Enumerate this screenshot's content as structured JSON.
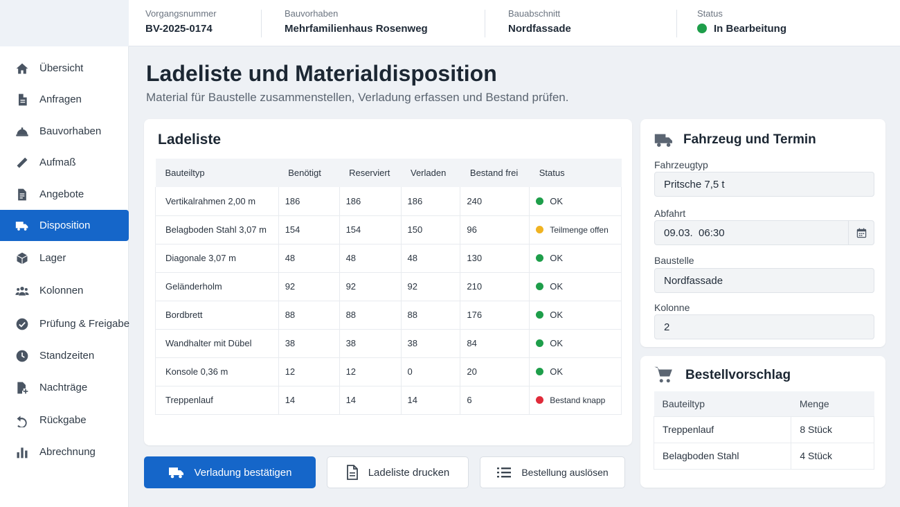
{
  "header": {
    "fields": [
      {
        "label": "Vorgangsnummer",
        "value": "BV-2025-0174"
      },
      {
        "label": "Bauvorhaben",
        "value": "Mehrfamilienhaus Rosenweg"
      },
      {
        "label": "Bauabschnitt",
        "value": "Nordfassade"
      },
      {
        "label": "Status",
        "value": "In Bearbeitung",
        "color": "#1e9e4a"
      }
    ]
  },
  "sidebar": {
    "items": [
      {
        "label": "Übersicht",
        "icon": "home-icon"
      },
      {
        "label": "Anfragen",
        "icon": "document-icon"
      },
      {
        "label": "Bauvorhaben",
        "icon": "helmet-icon"
      },
      {
        "label": "Aufmaß",
        "icon": "ruler-icon"
      },
      {
        "label": "Angebote",
        "icon": "document-lines-icon"
      },
      {
        "label": "Disposition",
        "icon": "truck-icon",
        "active": true
      },
      {
        "label": "Lager",
        "icon": "box-icon"
      },
      {
        "label": "Kolonnen",
        "icon": "team-icon"
      },
      {
        "label": "Prüfung & Freigabe",
        "icon": "check-circle-icon"
      },
      {
        "label": "Standzeiten",
        "icon": "clock-icon"
      },
      {
        "label": "Nachträge",
        "icon": "document-add-icon"
      },
      {
        "label": "Rückgabe",
        "icon": "undo-icon"
      },
      {
        "label": "Abrechnung",
        "icon": "bar-chart-icon"
      }
    ]
  },
  "page": {
    "title": "Ladeliste und Materialdisposition",
    "subtitle": "Material für Baustelle zusammenstellen, Verladung erfassen und Bestand prüfen."
  },
  "ladeliste": {
    "title": "Ladeliste",
    "columns": [
      "Bauteiltyp",
      "Benötigt",
      "Reserviert",
      "Verladen",
      "Bestand frei",
      "Status"
    ],
    "rows": [
      {
        "cells": [
          "Vertikalrahmen 2,00 m",
          "186",
          "186",
          "186",
          "240"
        ],
        "status": "OK",
        "level": "ok"
      },
      {
        "cells": [
          "Belagboden Stahl 3,07 m",
          "154",
          "154",
          "150",
          "96"
        ],
        "status": "Teilmenge offen",
        "level": "warn"
      },
      {
        "cells": [
          "Diagonale 3,07 m",
          "48",
          "48",
          "48",
          "130"
        ],
        "status": "OK",
        "level": "ok"
      },
      {
        "cells": [
          "Geländerholm",
          "92",
          "92",
          "92",
          "210"
        ],
        "status": "OK",
        "level": "ok"
      },
      {
        "cells": [
          "Bordbrett",
          "88",
          "88",
          "88",
          "176"
        ],
        "status": "OK",
        "level": "ok"
      },
      {
        "cells": [
          "Wandhalter mit Dübel",
          "38",
          "38",
          "38",
          "84"
        ],
        "status": "OK",
        "level": "ok"
      },
      {
        "cells": [
          "Konsole 0,36 m",
          "12",
          "12",
          "0",
          "20"
        ],
        "status": "OK",
        "level": "ok"
      },
      {
        "cells": [
          "Treppenlauf",
          "14",
          "14",
          "14",
          "6"
        ],
        "status": "Bestand knapp",
        "level": "bad"
      }
    ],
    "status_colors": {
      "ok": "#1e9e4a",
      "warn": "#f0b322",
      "bad": "#e02b3a"
    }
  },
  "vehicle": {
    "title": "Fahrzeug und Termin",
    "fields": [
      {
        "label": "Fahrzeugtyp",
        "value": "Pritsche 7,5 t"
      },
      {
        "label": "Abfahrt",
        "value": "09.03.  06:30"
      },
      {
        "label": "Baustelle",
        "value": "Nordfassade"
      },
      {
        "label": "Kolonne",
        "value": "2"
      }
    ]
  },
  "order": {
    "title": "Bestellvorschlag",
    "columns": [
      "Bauteiltyp",
      "Menge"
    ],
    "rows": [
      [
        "Treppenlauf",
        "8 Stück"
      ],
      [
        "Belagboden Stahl",
        "4 Stück"
      ]
    ]
  },
  "actions": {
    "confirm": "Verladung bestätigen",
    "print": "Ladeliste drucken",
    "order": "Bestellung auslösen"
  },
  "colors": {
    "accent": "#1566c9",
    "status_green": "#1e9e4a"
  }
}
